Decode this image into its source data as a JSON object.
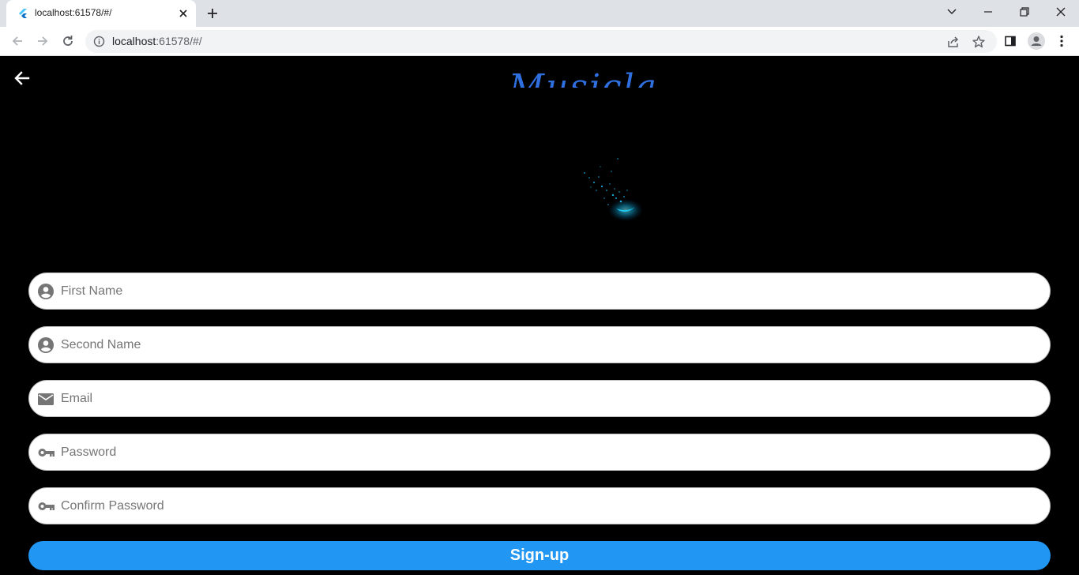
{
  "browser": {
    "tab_title": "localhost:61578/#/",
    "url_host": "localhost",
    "url_rest": ":61578/#/"
  },
  "form": {
    "first_name_placeholder": "First Name",
    "second_name_placeholder": "Second Name",
    "email_placeholder": "Email",
    "password_placeholder": "Password",
    "confirm_password_placeholder": "Confirm Password",
    "signup_label": "Sign-up"
  },
  "logo": {
    "text": "Musicla",
    "color": "#2f6fe0"
  },
  "colors": {
    "background": "#000000",
    "button": "#2196f3",
    "input_background": "#ffffff"
  }
}
